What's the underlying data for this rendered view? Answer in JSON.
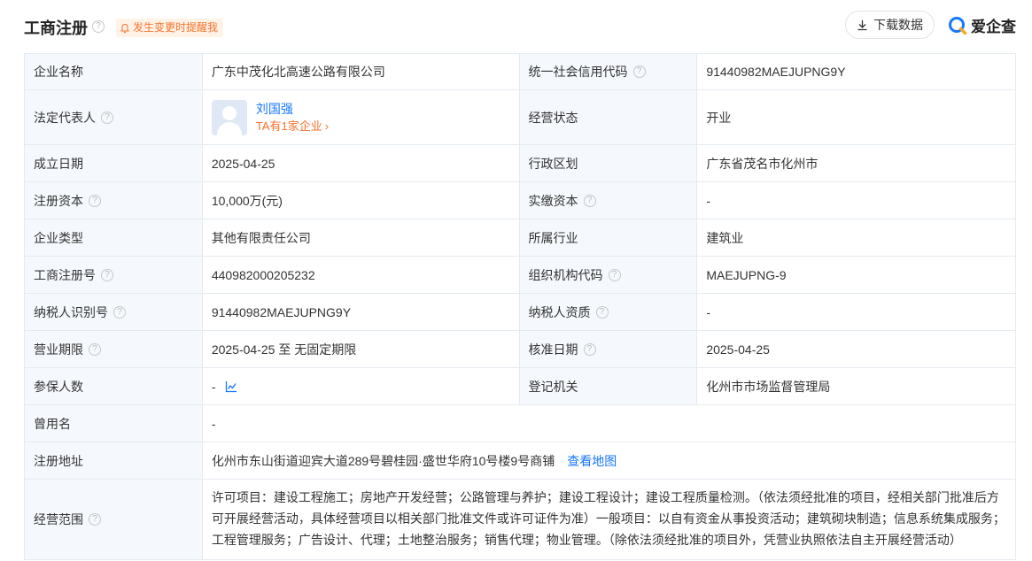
{
  "header": {
    "title": "工商注册",
    "help_glyph": "?",
    "alert_label": "发生变更时提醒我",
    "download_label": "下载数据",
    "brand_name": "爱企查"
  },
  "rows": {
    "r1": {
      "l1": "企业名称",
      "v1": "广东中茂化北高速公路有限公司",
      "l2": "统一社会信用代码",
      "v2": "91440982MAEJUPNG9Y"
    },
    "r2": {
      "l1": "法定代表人",
      "rep_name": "刘国强",
      "rep_sub": "TA有1家企业",
      "l2": "经营状态",
      "v2": "开业"
    },
    "r3": {
      "l1": "成立日期",
      "v1": "2025-04-25",
      "l2": "行政区划",
      "v2": "广东省茂名市化州市"
    },
    "r4": {
      "l1": "注册资本",
      "v1": "10,000万(元)",
      "l2": "实缴资本",
      "v2": "-"
    },
    "r5": {
      "l1": "企业类型",
      "v1": "其他有限责任公司",
      "l2": "所属行业",
      "v2": "建筑业"
    },
    "r6": {
      "l1": "工商注册号",
      "v1": "440982000205232",
      "l2": "组织机构代码",
      "v2": "MAEJUPNG-9"
    },
    "r7": {
      "l1": "纳税人识别号",
      "v1": "91440982MAEJUPNG9Y",
      "l2": "纳税人资质",
      "v2": "-"
    },
    "r8": {
      "l1": "营业期限",
      "v1": "2025-04-25 至 无固定期限",
      "l2": "核准日期",
      "v2": "2025-04-25"
    },
    "r9": {
      "l1": "参保人数",
      "v1": "-",
      "l2": "登记机关",
      "v2": "化州市市场监督管理局"
    },
    "r10": {
      "l1": "曾用名",
      "v1": "-"
    },
    "r11": {
      "l1": "注册地址",
      "v1": "化州市东山街道迎宾大道289号碧桂园·盛世华府10号楼9号商铺",
      "link": "查看地图"
    },
    "r12": {
      "l1": "经营范围",
      "v1": "许可项目：建设工程施工；房地产开发经营；公路管理与养护；建设工程设计；建设工程质量检测。（依法须经批准的项目，经相关部门批准后方可开展经营活动，具体经营项目以相关部门批准文件或许可证件为准）一般项目：以自有资金从事投资活动；建筑砌块制造；信息系统集成服务；工程管理服务；广告设计、代理；土地整治服务；销售代理；物业管理。（除依法须经批准的项目外，凭营业执照依法自主开展经营活动）"
    }
  },
  "colors": {
    "accent_blue": "#1677ff",
    "accent_orange": "#f5732c",
    "label_bg": "#f5f8fc",
    "border": "#e4eaf2"
  }
}
